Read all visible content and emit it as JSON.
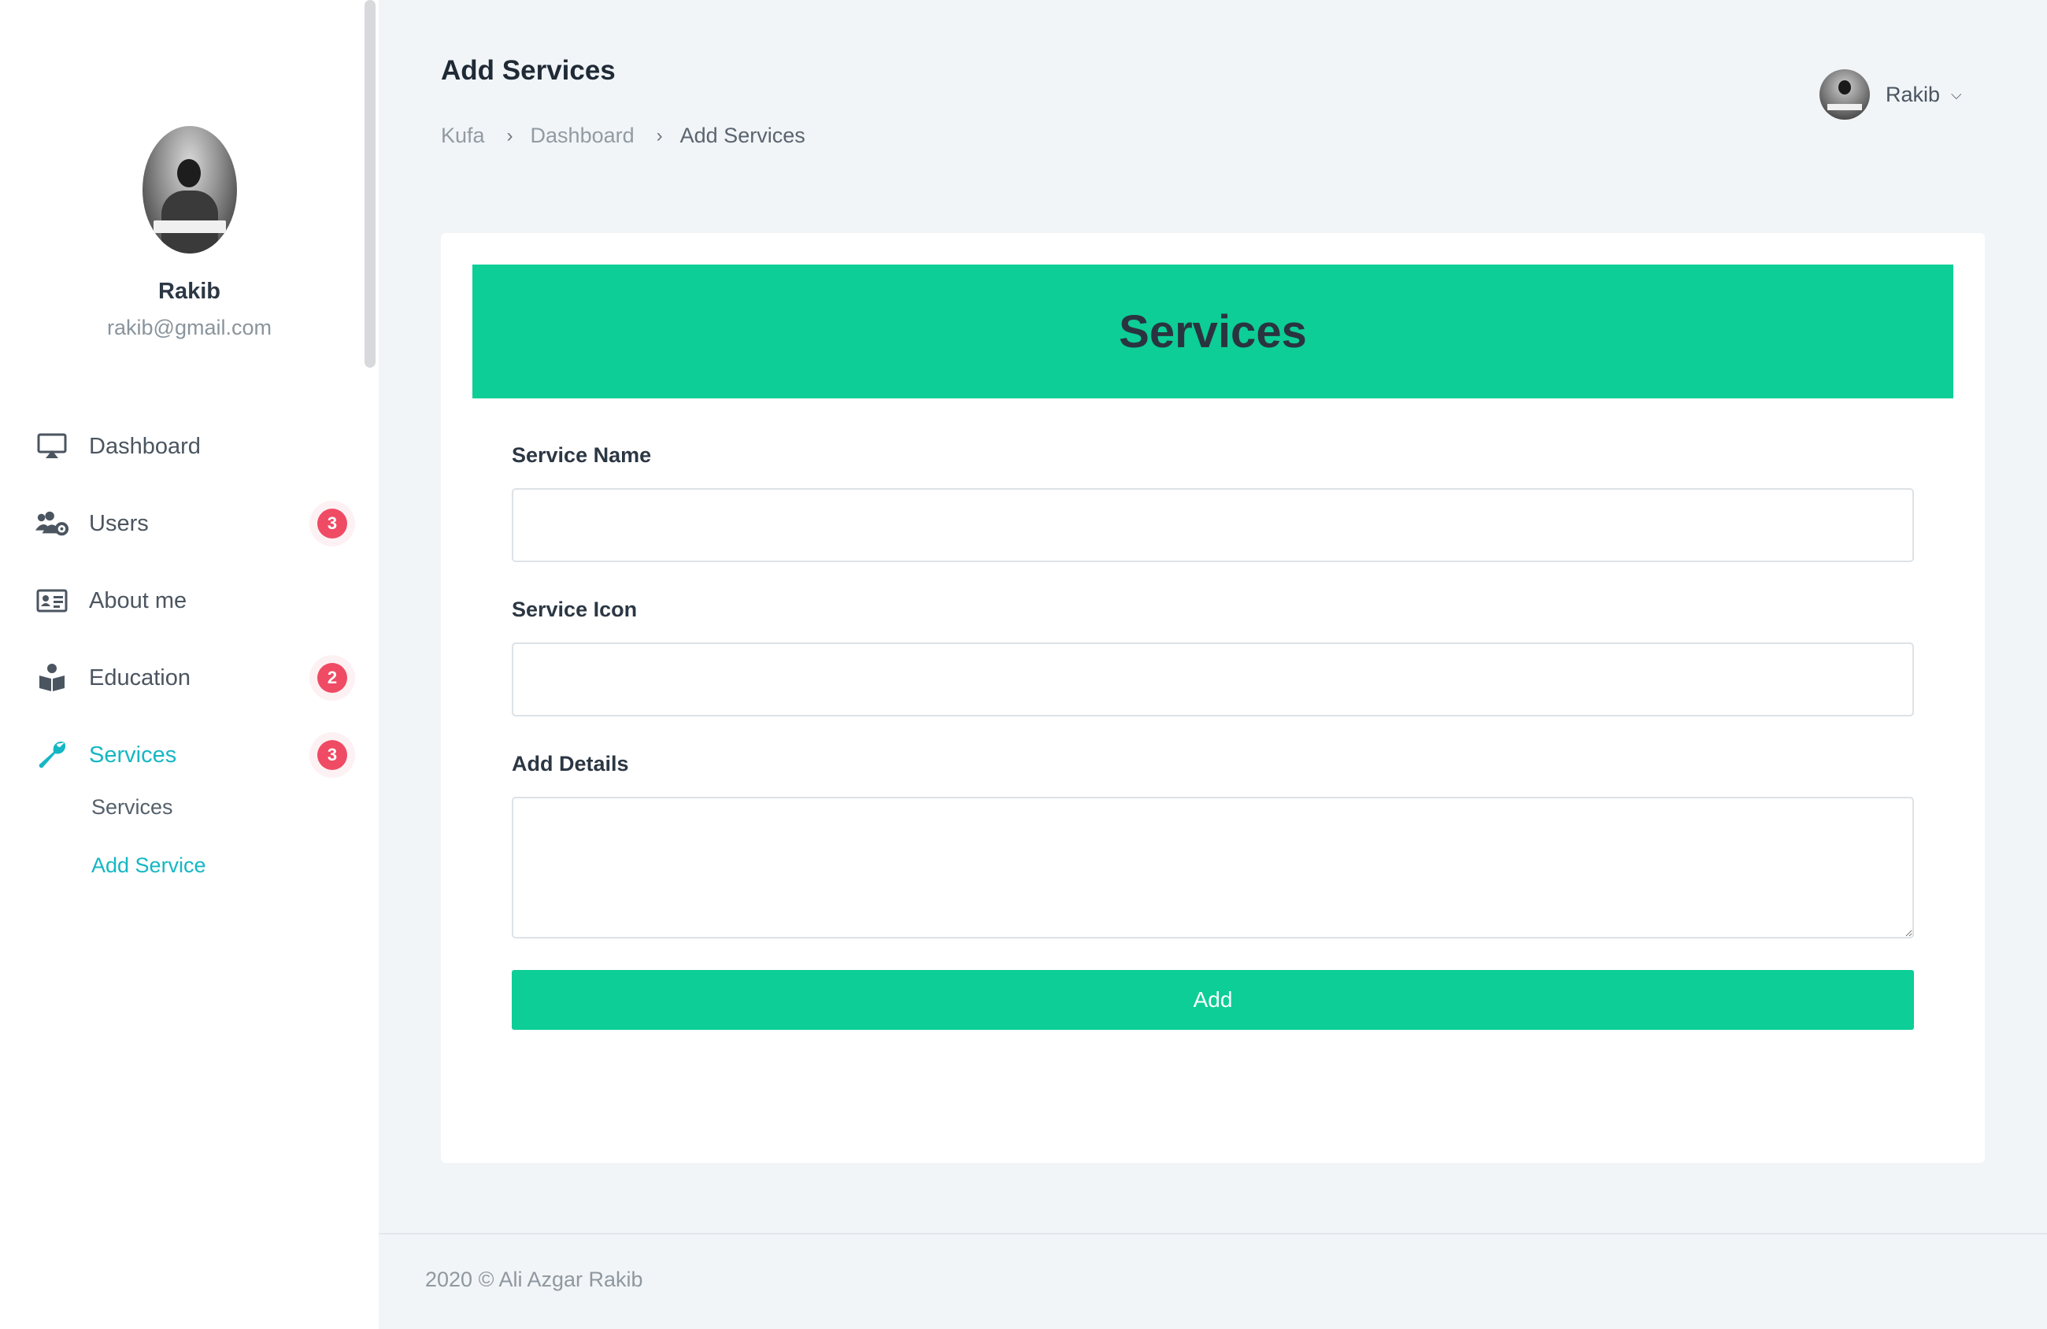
{
  "profile": {
    "name": "Rakib",
    "email": "rakib@gmail.com"
  },
  "nav": {
    "items": [
      {
        "label": "Dashboard",
        "icon": "monitor-icon",
        "badge": null,
        "active": false
      },
      {
        "label": "Users",
        "icon": "users-gear-icon",
        "badge": "3",
        "active": false
      },
      {
        "label": "About me",
        "icon": "id-card-icon",
        "badge": null,
        "active": false
      },
      {
        "label": "Education",
        "icon": "reader-icon",
        "badge": "2",
        "active": false
      },
      {
        "label": "Services",
        "icon": "wrench-icon",
        "badge": "3",
        "active": true
      }
    ],
    "subitems": [
      {
        "label": "Services",
        "active": false
      },
      {
        "label": "Add Service",
        "active": true
      }
    ]
  },
  "header": {
    "title": "Add Services",
    "breadcrumb": [
      "Kufa",
      "Dashboard",
      "Add Services"
    ],
    "user_name": "Rakib"
  },
  "form": {
    "banner_title": "Services",
    "service_name_label": "Service Name",
    "service_name_value": "",
    "service_icon_label": "Service Icon",
    "service_icon_value": "",
    "details_label": "Add Details",
    "details_value": "",
    "submit_label": "Add"
  },
  "footer": {
    "text": "2020 © Ali Azgar Rakib"
  },
  "colors": {
    "accent_green": "#0dce96",
    "active_teal": "#15b7c3",
    "badge_red": "#ef4b64",
    "background": "#f1f5f8"
  }
}
